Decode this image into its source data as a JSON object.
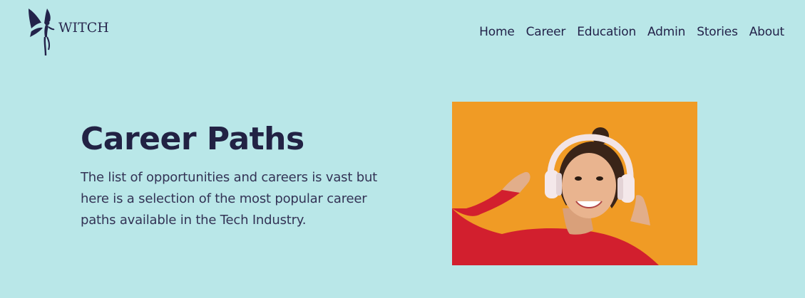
{
  "header": {
    "logo_text": "WITCH",
    "logo_icon": "fairy-silhouette-icon",
    "nav": [
      {
        "label": "Home"
      },
      {
        "label": "Career"
      },
      {
        "label": "Education"
      },
      {
        "label": "Admin"
      },
      {
        "label": "Stories"
      },
      {
        "label": "About"
      }
    ]
  },
  "hero": {
    "title": "Career Paths",
    "description": "The list of opportunities and careers is vast but here is a selection of the most popular career paths available in the Tech Industry.",
    "image": "woman-with-headphones-photo"
  },
  "colors": {
    "background": "#b9e7e8",
    "text": "#23234a",
    "image_background": "#f09b25",
    "sweater": "#d21f2e"
  }
}
